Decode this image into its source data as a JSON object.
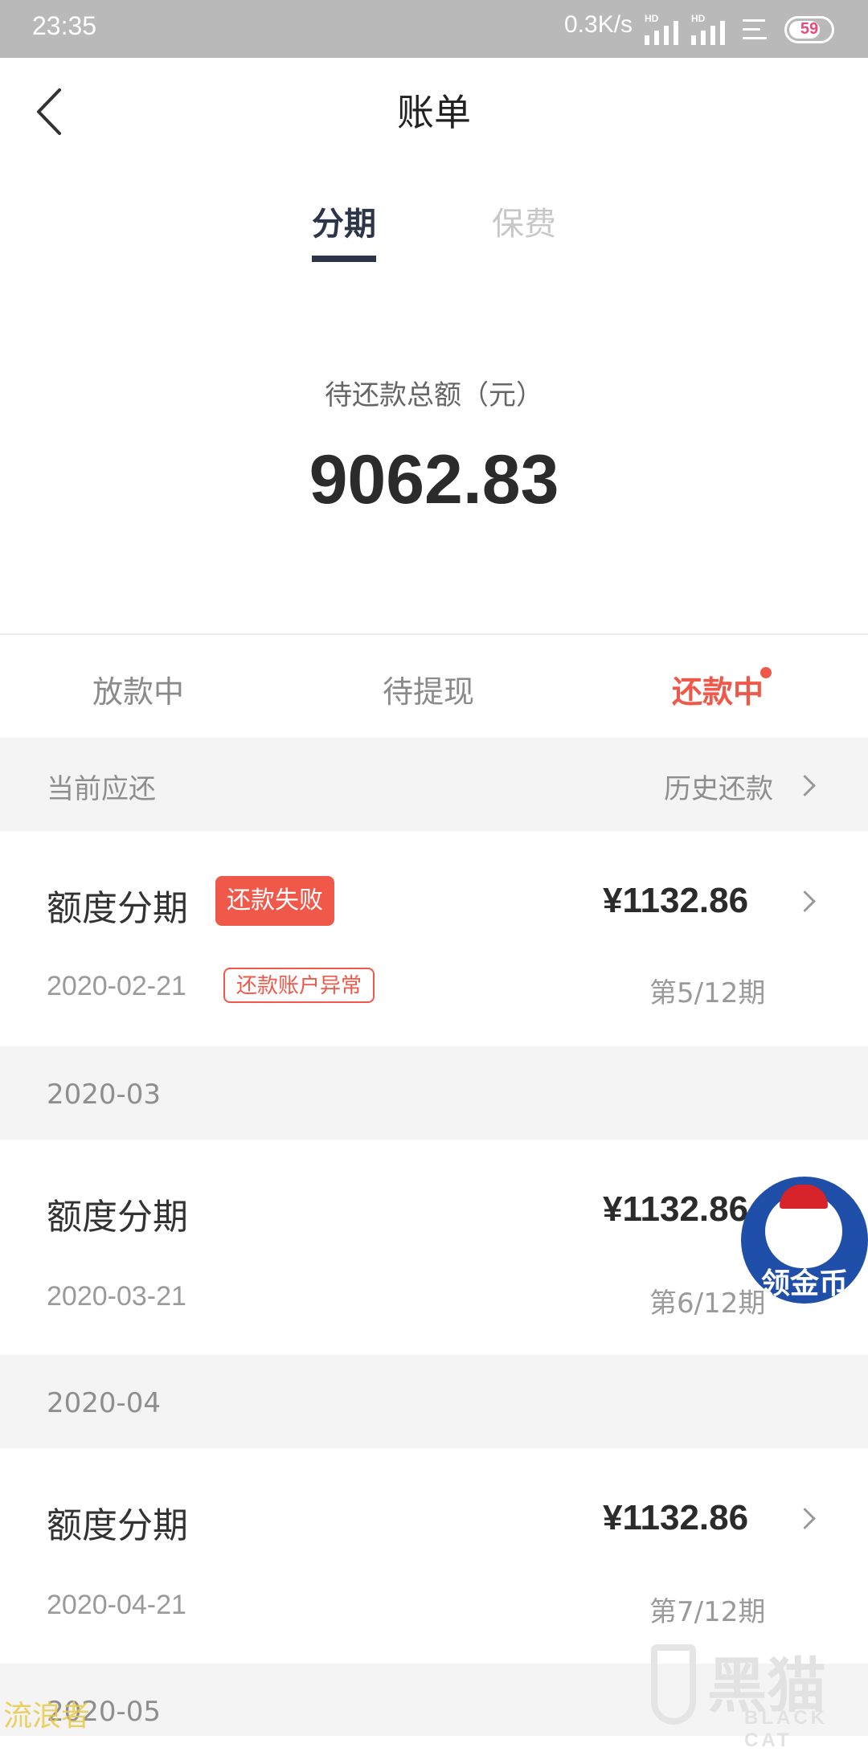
{
  "status_bar": {
    "time": "23:35",
    "net_speed": "0.3K/s",
    "battery_level": "59",
    "sim_tags": [
      "HD",
      "HD"
    ]
  },
  "header": {
    "title": "账单"
  },
  "top_tabs": [
    {
      "label": "分期",
      "active": true
    },
    {
      "label": "保费",
      "active": false
    }
  ],
  "summary": {
    "label": "待还款总额（元）",
    "amount": "9062.83"
  },
  "status_tabs": [
    {
      "label": "放款中",
      "active": false
    },
    {
      "label": "待提现",
      "active": false
    },
    {
      "label": "还款中",
      "active": true,
      "has_dot": true
    }
  ],
  "current_section": {
    "label": "当前应还",
    "history_label": "历史还款"
  },
  "bills": [
    {
      "title": "额度分期",
      "amount": "¥1132.86",
      "date": "2020-02-21",
      "period": "第5/12期",
      "status_badge": "还款失败",
      "note_badge": "还款账户异常"
    },
    {
      "month": "2020-03",
      "title": "额度分期",
      "amount": "¥1132.86",
      "date": "2020-03-21",
      "period": "第6/12期"
    },
    {
      "month": "2020-04",
      "title": "额度分期",
      "amount": "¥1132.86",
      "date": "2020-04-21",
      "period": "第7/12期"
    },
    {
      "month": "2020-05"
    }
  ],
  "floating_widget": {
    "label": "领金币"
  },
  "watermarks": {
    "left": "流浪者",
    "brand_cn": "黑猫",
    "brand_en": "BLACK CAT"
  },
  "colors": {
    "accent": "#f0584a",
    "tab_active": "#2d3548",
    "status_bar": "#b9b9b9",
    "section_bg": "#f4f4f4"
  }
}
